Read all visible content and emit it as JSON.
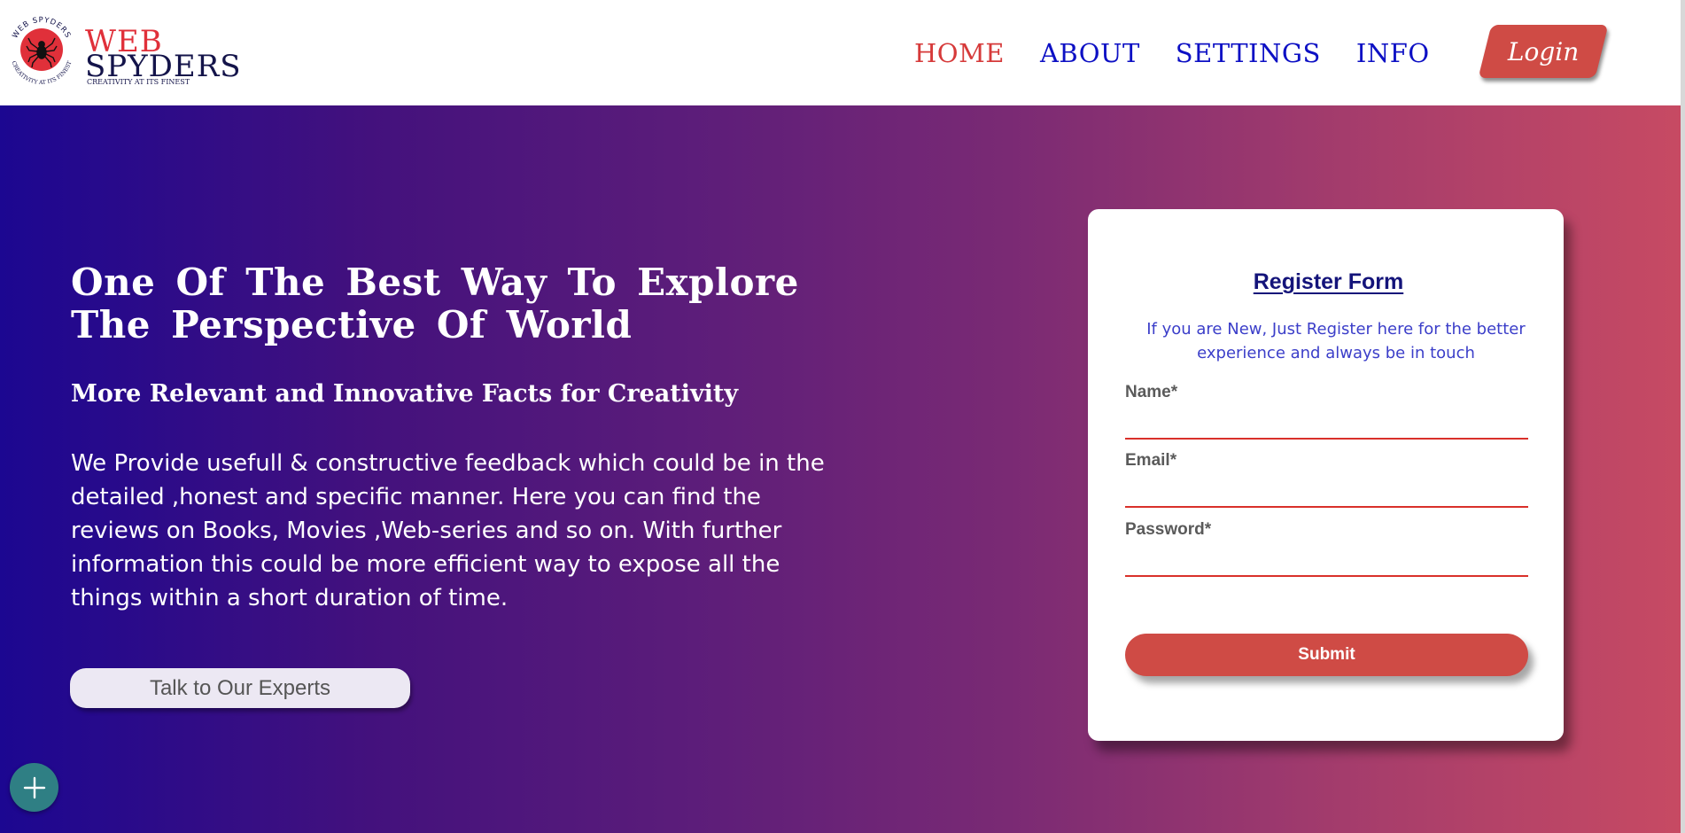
{
  "brand": {
    "seal_text": "WEB SPYDERS",
    "seal_tagline": "CREATIVITY AT ITS FINEST",
    "name_line1": "WEB",
    "name_line2": "SPYDERS",
    "tagline": "CREATIVITY AT ITS FINEST",
    "icon": "spider-icon"
  },
  "nav": {
    "items": [
      {
        "label": "HOME",
        "active": true
      },
      {
        "label": "ABOUT",
        "active": false
      },
      {
        "label": "SETTINGS",
        "active": false
      },
      {
        "label": "INFO",
        "active": false
      }
    ],
    "login_label": "Login"
  },
  "hero": {
    "title": "One Of The Best Way To Explore The Perspective Of World",
    "subtitle": "More Relevant and Innovative Facts for Creativity",
    "body": "We Provide usefull & constructive feedback which could be in the detailed ,honest and specific manner. Here you can find the reviews on Books, Movies ,Web-series and so on. With further information this could be more efficient way to expose all the things within a short duration of time.",
    "cta_label": "Talk to Our Experts"
  },
  "register": {
    "title": "Register Form",
    "subtitle": "If you are New, Just Register here for the better experience and always be in touch",
    "fields": [
      {
        "label": "Name*",
        "value": ""
      },
      {
        "label": "Email*",
        "value": ""
      },
      {
        "label": "Password*",
        "value": ""
      }
    ],
    "submit_label": "Submit"
  },
  "fab": {
    "icon": "plus-icon"
  },
  "colors": {
    "accent_red": "#cf4b45",
    "nav_blue": "#0d10c4",
    "nav_active": "#d63a3a",
    "gradient_start": "#1c0791",
    "gradient_end": "#c74a63",
    "fab_teal": "#2f7f84"
  }
}
